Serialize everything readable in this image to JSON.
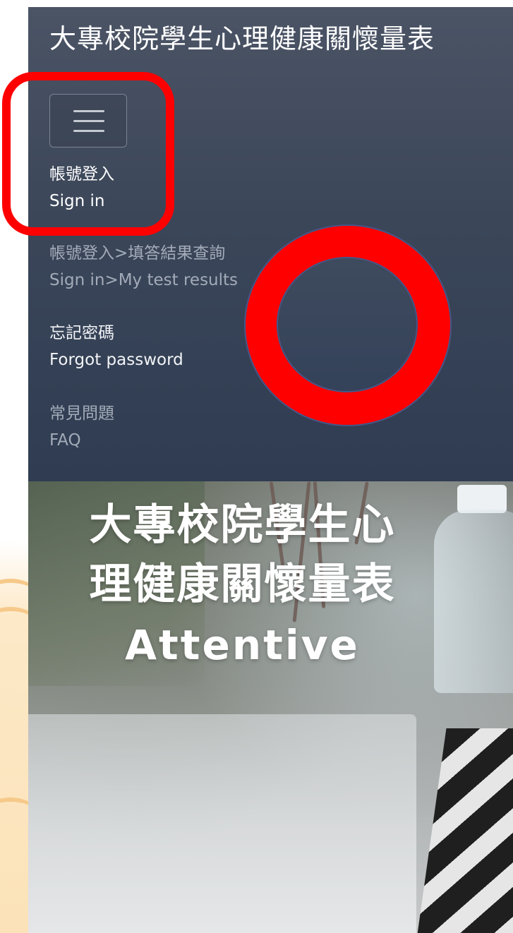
{
  "navbar": {
    "brand": "大專校院學生心理健康關懷量表",
    "toggle_icon": "hamburger-menu-icon",
    "items": [
      {
        "zh": "帳號登入",
        "en": "Sign in"
      },
      {
        "zh": "帳號登入>填答結果查詢",
        "en": "Sign in>My test results"
      },
      {
        "zh": "忘記密碼",
        "en": "Forgot password"
      },
      {
        "zh": "常見問題",
        "en": "FAQ"
      }
    ]
  },
  "hero": {
    "title_line1": "大專校院學生心",
    "title_line2": "理健康關懷量表",
    "title_line3": "Attentive"
  },
  "colors": {
    "navbar": "#3b4659",
    "annotation": "#ff0000",
    "hero_text": "#ffffff"
  }
}
